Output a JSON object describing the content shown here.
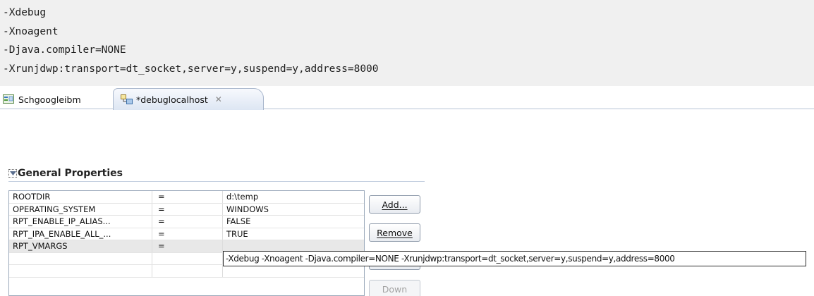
{
  "code_block": {
    "lines": [
      "-Xdebug",
      "-Xnoagent",
      "-Djava.compiler=NONE",
      "-Xrunjdwp:transport=dt_socket,server=y,suspend=y,address=8000"
    ]
  },
  "tabs": [
    {
      "label": "Schgoogleibm",
      "icon": "test-schedule-icon",
      "active": false
    },
    {
      "label": "*debuglocalhost",
      "icon": "location-icon",
      "active": true,
      "close_glyph": "✕"
    }
  ],
  "section": {
    "title": "General Properties",
    "twistie_icon": "expand-triangle-icon"
  },
  "properties": {
    "rows": [
      {
        "name": "ROOTDIR",
        "op": "=",
        "value": "d:\\temp"
      },
      {
        "name": "OPERATING_SYSTEM",
        "op": "=",
        "value": "WINDOWS"
      },
      {
        "name": "RPT_ENABLE_IP_ALIAS...",
        "op": "=",
        "value": "FALSE"
      },
      {
        "name": "RPT_IPA_ENABLE_ALL_...",
        "op": "=",
        "value": "TRUE"
      },
      {
        "name": "RPT_VMARGS",
        "op": "=",
        "value": ""
      },
      {
        "name": "",
        "op": "",
        "value": ""
      },
      {
        "name": "",
        "op": "",
        "value": ""
      }
    ],
    "selected_row": 4
  },
  "buttons": {
    "add": "Add...",
    "remove": "Remove",
    "down": "Down"
  },
  "tooltip": {
    "text": "-Xdebug -Xnoagent -Djava.compiler=NONE -Xrunjdwp:transport=dt_socket,server=y,suspend=y,address=8000"
  },
  "colors": {
    "code_bg": "#f0f0f0",
    "tab_active_bg": "#dde6f3",
    "selected_row_bg": "#e8e8e8"
  }
}
